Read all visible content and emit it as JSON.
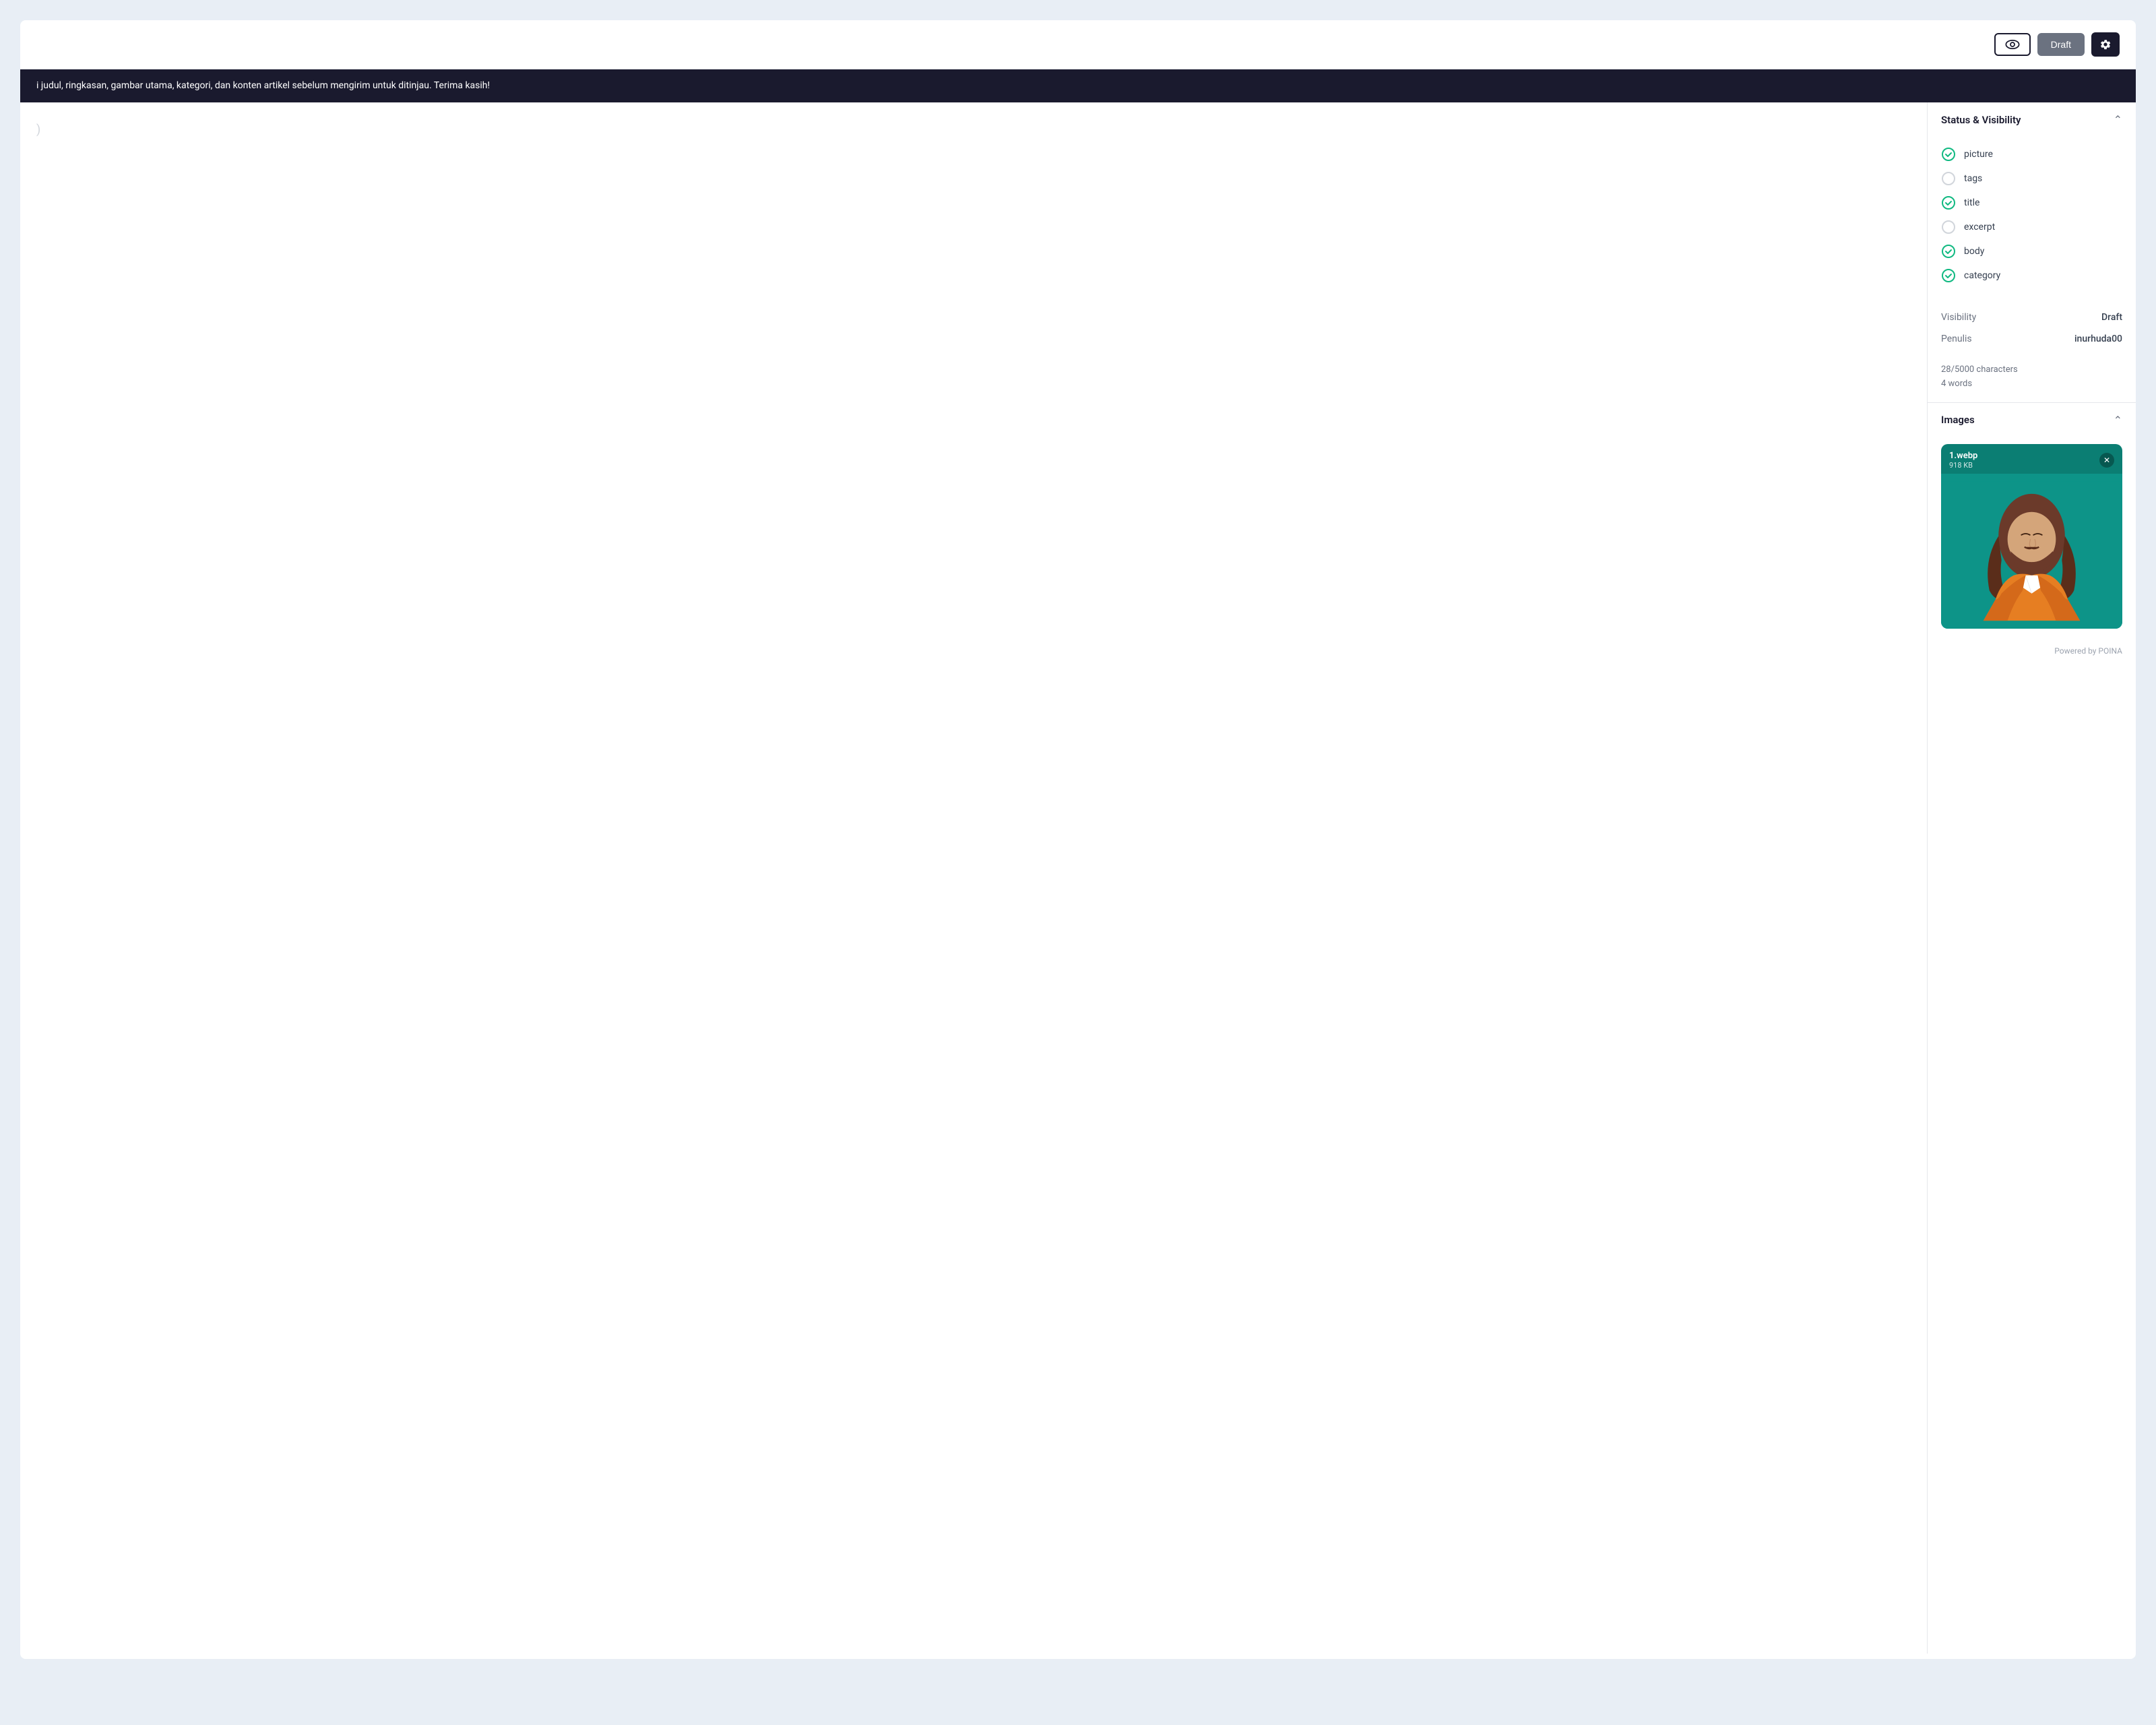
{
  "header": {
    "preview_label": "👁",
    "draft_button": "Draft",
    "settings_button": "settings"
  },
  "banner": {
    "text": "i judul, ringkasan, gambar utama, kategori, dan konten artikel sebelum mengirim untuk ditinjau. Terima kasih!"
  },
  "sidebar": {
    "status_visibility": {
      "title": "Status & Visibility",
      "checklist": [
        {
          "label": "picture",
          "checked": true
        },
        {
          "label": "tags",
          "checked": false
        },
        {
          "label": "title",
          "checked": true
        },
        {
          "label": "excerpt",
          "checked": false
        },
        {
          "label": "body",
          "checked": true
        },
        {
          "label": "category",
          "checked": true
        }
      ],
      "visibility_label": "Visibility",
      "visibility_value": "Draft",
      "penulis_label": "Penulis",
      "penulis_value": "inurhuda00",
      "characters": "28/5000 characters",
      "words": "4 words"
    },
    "images": {
      "title": "Images",
      "image": {
        "filename": "1.webp",
        "filesize": "918 KB"
      }
    },
    "footer": {
      "powered_by": "Powered by POINA"
    }
  }
}
